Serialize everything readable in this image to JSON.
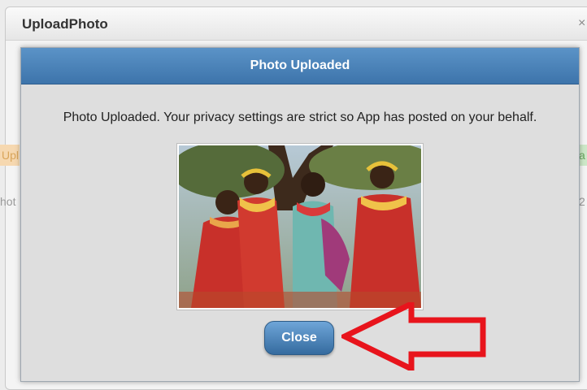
{
  "window": {
    "title": "UploadPhoto",
    "close_glyph": "×"
  },
  "background": {
    "left_tab": "Upl",
    "right_tab": "a",
    "left_text": "hot",
    "right_text": "2"
  },
  "dialog": {
    "title": "Photo Uploaded",
    "message": "Photo Uploaded. Your privacy settings are strict so App has posted on your behalf.",
    "photo_icon": "uploaded-photo",
    "close_label": "Close",
    "header_color": "#4a82b8",
    "button_color": "#4a82b8"
  },
  "annotation": {
    "arrow_color": "#e8141c",
    "arrow_icon": "arrow-left-icon"
  }
}
